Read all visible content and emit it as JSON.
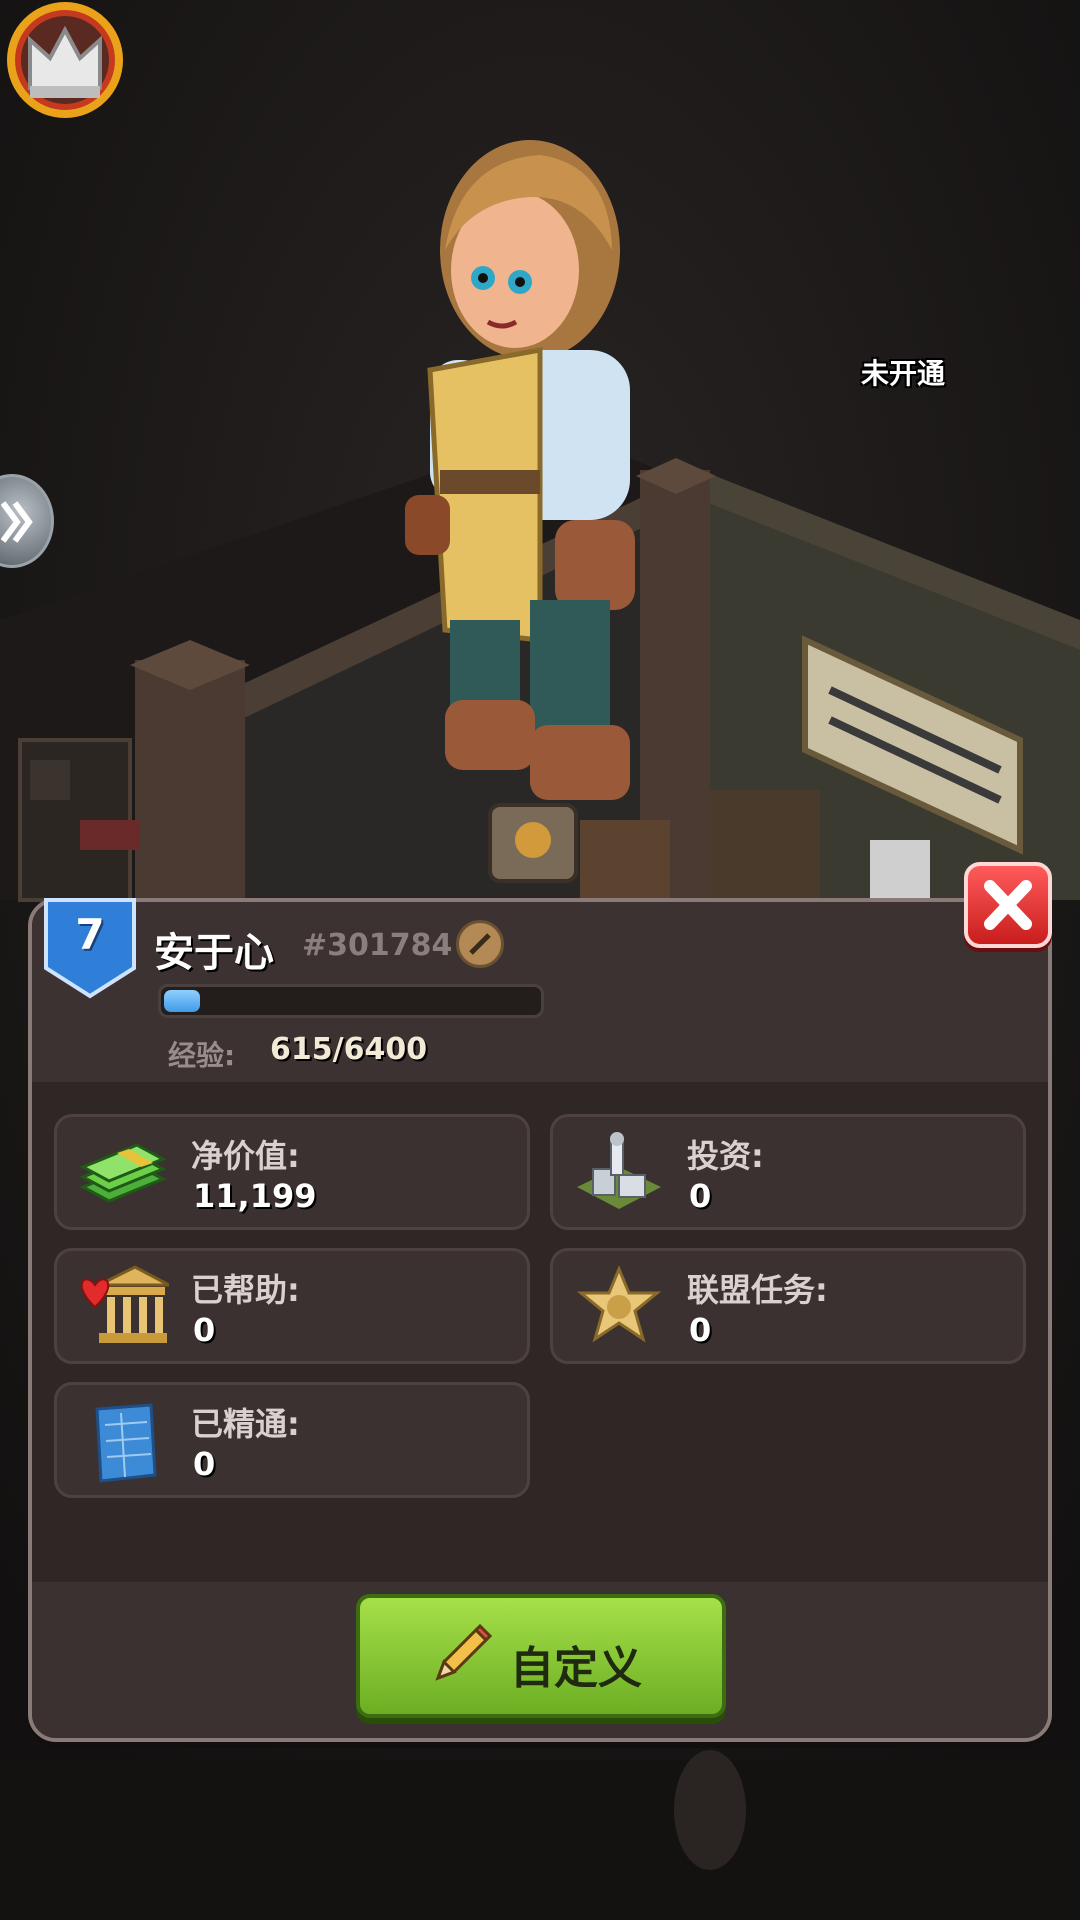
{
  "hud": {
    "crown_badge_label": "未开通",
    "side_toggle_icon": "double-chevron-right-icon"
  },
  "profile": {
    "level": "7",
    "name": "安于心",
    "id_tag": "#301784",
    "xp_label": "经验:",
    "xp_value": "615/6400",
    "xp_fraction": 0.096
  },
  "stats": [
    {
      "key": "net_worth",
      "label": "净价值:",
      "value": "11,199",
      "icon": "cash-stack-icon"
    },
    {
      "key": "investment",
      "label": "投资:",
      "value": "0",
      "icon": "building-complex-icon"
    },
    {
      "key": "helped",
      "label": "已帮助:",
      "value": "0",
      "icon": "charity-bank-heart-icon"
    },
    {
      "key": "alliance_tasks",
      "label": "联盟任务:",
      "value": "0",
      "icon": "sheriff-star-icon"
    },
    {
      "key": "mastered",
      "label": "已精通:",
      "value": "0",
      "icon": "blueprint-icon"
    }
  ],
  "actions": {
    "customize_label": "自定义",
    "close_icon": "close-icon"
  },
  "colors": {
    "panel_bg": "#2e2726",
    "level_badge": "#2f7fd8",
    "xp_fill": "#3f9be8",
    "button_green": "#8fd13a",
    "close_red": "#e03030"
  }
}
